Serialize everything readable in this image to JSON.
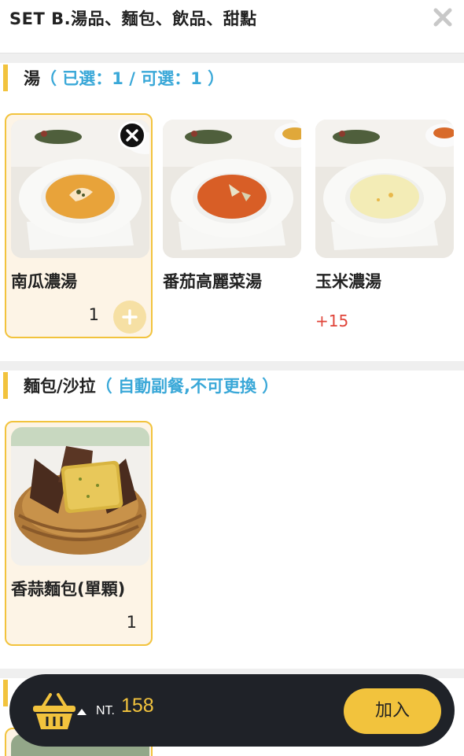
{
  "header": {
    "title": "SET B.湯品、麵包、飲品、甜點",
    "close_icon": "close-icon"
  },
  "sections": [
    {
      "title": "湯",
      "note": "（ 已選：1 / 可選：1 ）",
      "items": [
        {
          "name": "南瓜濃湯",
          "qty": "1",
          "selected": true
        },
        {
          "name": "番茄高麗菜湯",
          "selected": false
        },
        {
          "name": "玉米濃湯",
          "price": "+15",
          "selected": false
        }
      ]
    },
    {
      "title": "麵包/沙拉",
      "note": "（ 自動副餐,不可更換 ）",
      "items": [
        {
          "name": "香蒜麵包(單顆)",
          "qty": "1",
          "selected": true
        }
      ]
    }
  ],
  "cart": {
    "currency": "NT.",
    "total": "158",
    "add_label": "加入",
    "accent_color": "#f2c33d",
    "bar_color": "#1f2228"
  }
}
